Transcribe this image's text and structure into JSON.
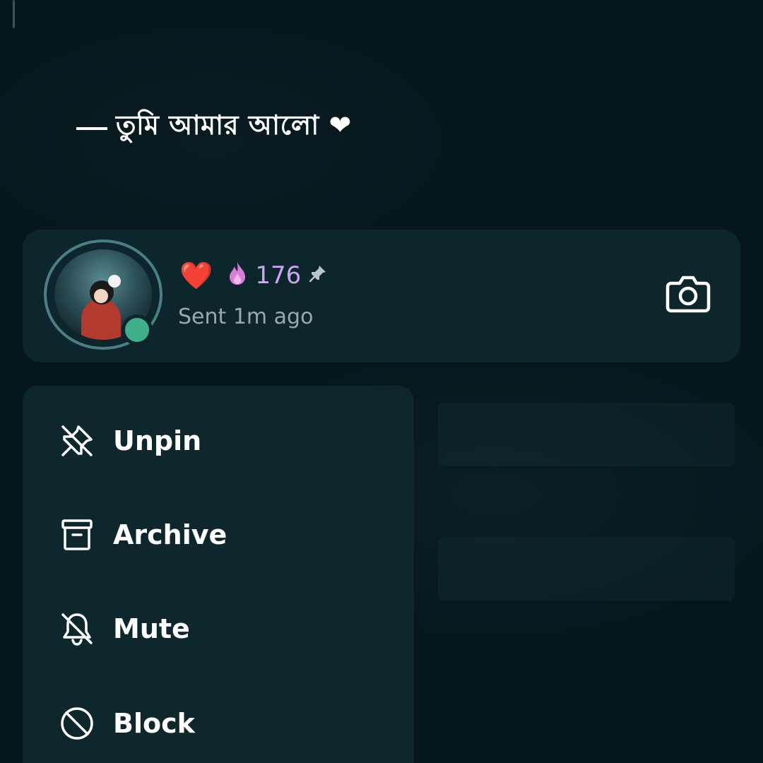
{
  "caption": {
    "text": "তুমি আমার আলো ❤"
  },
  "chat_item": {
    "heart_icon": "❤️",
    "streak_icon": "flame-icon",
    "streak_count": "176",
    "pin_icon": "pin-icon",
    "subtitle": "Sent 1m ago",
    "camera_icon": "camera-icon",
    "online_color": "#3fae8a"
  },
  "context_menu": {
    "items": [
      {
        "label": "Unpin",
        "icon": "unpin-icon"
      },
      {
        "label": "Archive",
        "icon": "archive-icon"
      },
      {
        "label": "Mute",
        "icon": "mute-bell-icon"
      },
      {
        "label": "Block",
        "icon": "block-icon"
      }
    ]
  },
  "colors": {
    "background": "#06171c",
    "card": "#0d262c",
    "menu": "#0e272d",
    "streak": "#cba5f0"
  }
}
